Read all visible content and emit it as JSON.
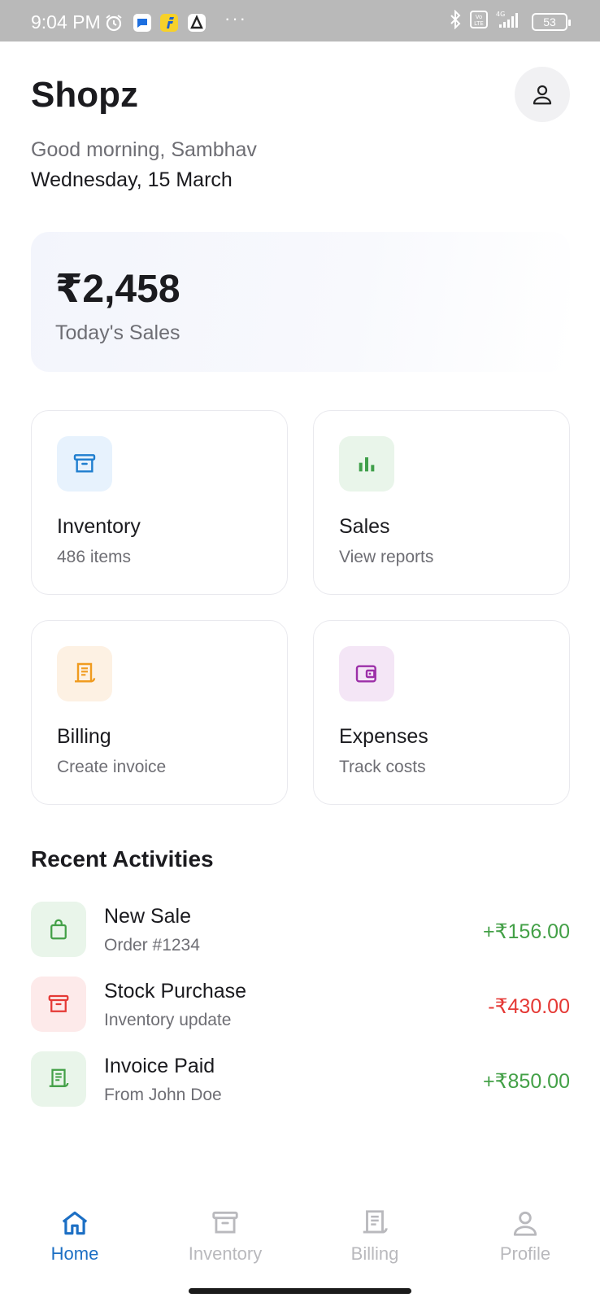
{
  "status_bar": {
    "time": "9:04 PM",
    "battery": "53",
    "icons": [
      "alarm-icon",
      "message-app-icon",
      "flipkart-app-icon",
      "app-icon",
      "bluetooth-icon",
      "volte-icon",
      "signal-icon",
      "battery-icon"
    ]
  },
  "header": {
    "title": "Shopz",
    "greeting": "Good morning, Sambhav",
    "date": "Wednesday, 15 March"
  },
  "sales_card": {
    "amount": "₹2,458",
    "label": "Today's Sales"
  },
  "tiles": [
    {
      "title": "Inventory",
      "subtitle": "486 items",
      "icon": "archive-box-icon",
      "icon_color": "#1f7ecf",
      "bg": "#e7f2fd"
    },
    {
      "title": "Sales",
      "subtitle": "View reports",
      "icon": "bar-chart-icon",
      "icon_color": "#3f9f4a",
      "bg": "#e9f5ea"
    },
    {
      "title": "Billing",
      "subtitle": "Create invoice",
      "icon": "receipt-icon",
      "icon_color": "#f09b1f",
      "bg": "#fdf1e3"
    },
    {
      "title": "Expenses",
      "subtitle": "Track costs",
      "icon": "wallet-icon",
      "icon_color": "#9c2fa8",
      "bg": "#f4e6f6"
    }
  ],
  "recent": {
    "title": "Recent Activities",
    "items": [
      {
        "title": "New Sale",
        "subtitle": "Order #1234",
        "amount": "+₹156.00",
        "icon": "shopping-bag-icon",
        "color": "#43a047",
        "bg": "#e9f5ea"
      },
      {
        "title": "Stock Purchase",
        "subtitle": "Inventory update",
        "amount": "-₹430.00",
        "icon": "archive-box-icon",
        "color": "#e53935",
        "bg": "#fdeaea"
      },
      {
        "title": "Invoice Paid",
        "subtitle": "From John Doe",
        "amount": "+₹850.00",
        "icon": "receipt-icon",
        "color": "#43a047",
        "bg": "#e9f5ea"
      }
    ]
  },
  "bottom_nav": {
    "items": [
      {
        "label": "Home",
        "icon": "home-icon",
        "active": true
      },
      {
        "label": "Inventory",
        "icon": "archive-box-icon",
        "active": false
      },
      {
        "label": "Billing",
        "icon": "receipt-icon",
        "active": false
      },
      {
        "label": "Profile",
        "icon": "person-icon",
        "active": false
      }
    ],
    "active_color": "#1c6fc4",
    "inactive_color": "#b9b9bd"
  }
}
